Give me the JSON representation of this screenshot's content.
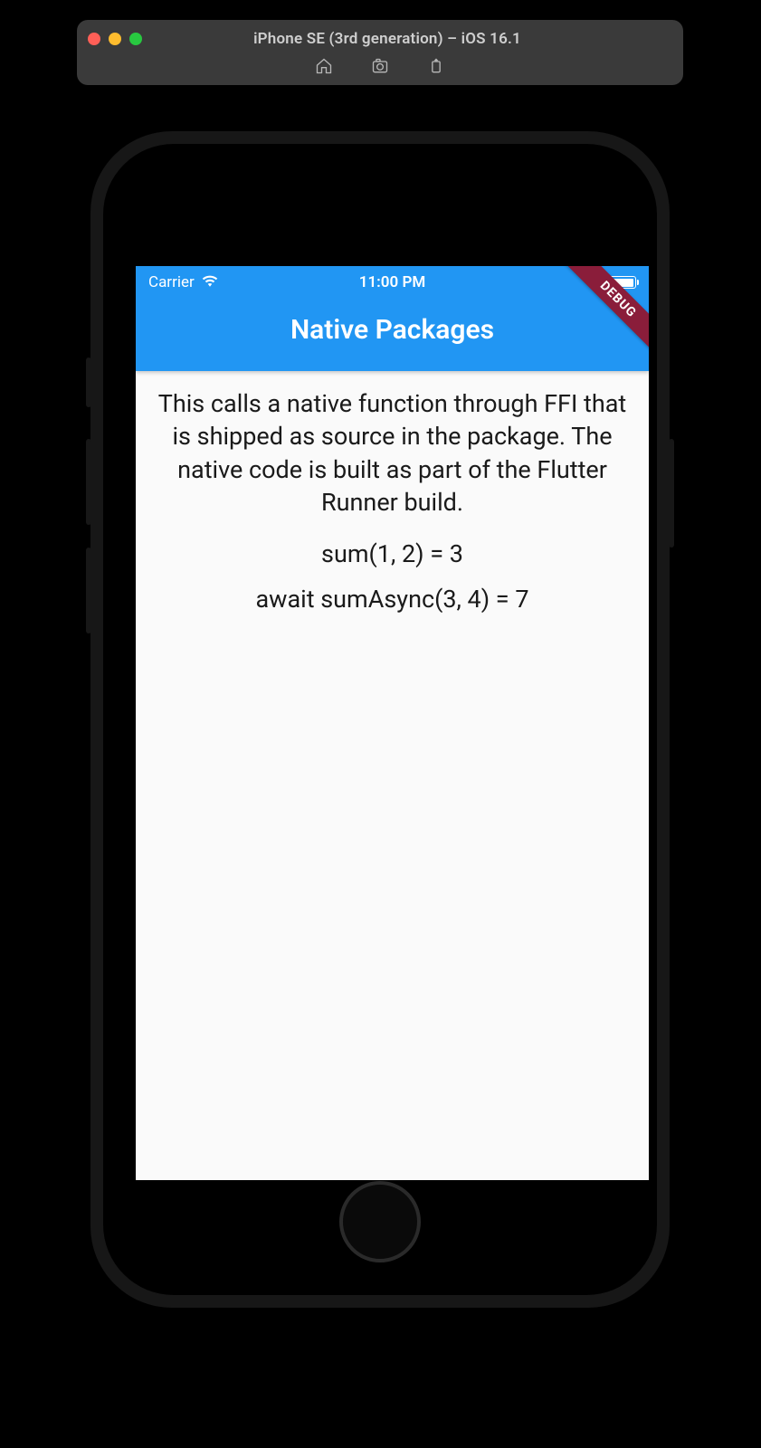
{
  "simulator": {
    "title": "iPhone SE (3rd generation) – iOS 16.1",
    "toolbar_icons": [
      "home-icon",
      "screenshot-icon",
      "rotate-icon"
    ]
  },
  "status_bar": {
    "carrier": "Carrier",
    "time": "11:00 PM"
  },
  "appbar": {
    "title": "Native Packages",
    "debug_label": "DEBUG"
  },
  "body": {
    "description": "This calls a native function through FFI that is shipped as source in the package. The native code is built as part of the Flutter Runner build.",
    "result_sync": "sum(1, 2) = 3",
    "result_async": "await sumAsync(3, 4) = 7"
  }
}
